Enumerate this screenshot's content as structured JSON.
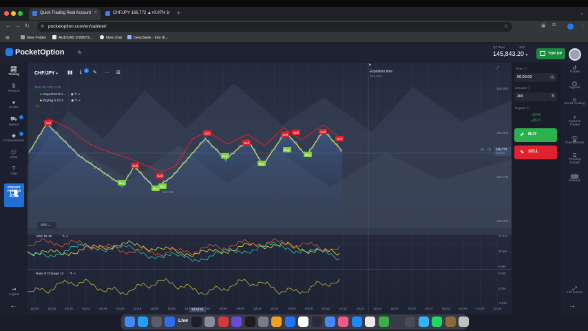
{
  "browser": {
    "tabs": [
      {
        "title": "Quick Trading Real Account",
        "active": true
      },
      {
        "title": "CHF/JPY 166.772 ▲+0.07% 1",
        "active": false
      }
    ],
    "url": "pocketoption.com/en/cabinet/",
    "bookmarks": [
      "New Folder",
      "AUDCAD 0.89673...",
      "New chat",
      "DeepSeek - Into th..."
    ]
  },
  "header": {
    "logo_text": "PocketOption",
    "account_type": "QT Real",
    "currency": "USD",
    "balance": "145,843.20",
    "topup_label": "TOP UP"
  },
  "left_sidebar": {
    "items": [
      {
        "label": "Trading",
        "icon": "chart-icon"
      },
      {
        "label": "Finance",
        "icon": "dollar-icon"
      },
      {
        "label": "Profile",
        "icon": "user-icon"
      },
      {
        "label": "Market",
        "icon": "cart-icon"
      },
      {
        "label": "Achievements",
        "icon": "diamond-icon"
      },
      {
        "label": "Chat",
        "icon": "chat-icon"
      },
      {
        "label": "Help",
        "icon": "help-icon"
      }
    ],
    "friends_label_1": "POCKET",
    "friends_label_2": "FRIENDS",
    "logout_label": "Logout"
  },
  "chart_toolbar": {
    "pair": "CHF/JPY",
    "badge": "2",
    "clock": "19:11:31 UTC+2",
    "indicators": [
      "SuperTrend 1...",
      "ZigZag 5 12 3"
    ]
  },
  "expiration": {
    "label": "Expiration time",
    "time": "19:14:51"
  },
  "y_axis": [
    "166.900",
    "166.800",
    "166.700",
    "166.600"
  ],
  "x_axis": [
    "18:36",
    "18:38",
    "18:40",
    "18:42",
    "18:44",
    "18:46",
    "18:48",
    "18:50",
    "18:52",
    "18:54",
    "18:56",
    "18:58",
    "19:00",
    "19:02",
    "19:04",
    "19:06",
    "19:08",
    "19:10",
    "19:12",
    "19:14",
    "19:16",
    "19:18",
    "19:20",
    "19:22",
    "19:24",
    "19:26",
    "19:28",
    "19:30"
  ],
  "cursor_time": "18:54:54",
  "price_tag": {
    "price": "166.773",
    "sub": "00:03:00"
  },
  "timeframe": "M56",
  "markers": {
    "sell": "Sell",
    "buy": "Buy"
  },
  "low_label": "166.689",
  "sub_panels": {
    "adx_label": "ADX 15 15",
    "adx_values": [
      "47.213",
      "26.591",
      "5.969"
    ],
    "roc_label": "Rate of Change 14",
    "roc_values": [
      "0.048",
      "0.006",
      "-0.035"
    ]
  },
  "trade_panel": {
    "time_label": "Time",
    "time_value": "00:03:00",
    "amount_label": "Amount",
    "amount_value": "300",
    "payout_label": "Payout",
    "payout_pct": "+91%",
    "payout_amount": "+$573",
    "buy_label": "BUY",
    "sell_label": "SELL"
  },
  "right_sidebar": {
    "items": [
      {
        "label": "Trades"
      },
      {
        "label": "Signals"
      },
      {
        "label": "Social Trading"
      },
      {
        "label": "Express Trades"
      },
      {
        "label": "Tournaments"
      },
      {
        "label": "Pending Trades"
      },
      {
        "label": "Hotkeys"
      }
    ],
    "fullscreen_label": "Full screen"
  },
  "colors": {
    "buy": "#2bb24c",
    "sell": "#e0222e",
    "accent": "#1e7cf2",
    "supertrend_up": "#e8e23a",
    "supertrend_down": "#e0222e",
    "price_line": "#5a9cf0"
  },
  "dock": {
    "live_label": "Live"
  }
}
